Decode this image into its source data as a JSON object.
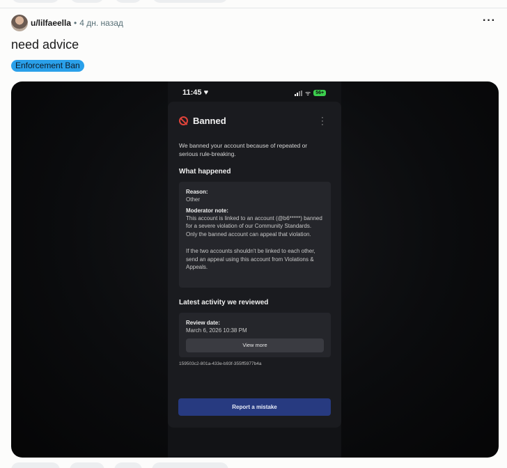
{
  "post": {
    "username": "u/lilfaeella",
    "separator": "•",
    "time_ago": "4 дн. назад",
    "more_label": "···",
    "title": "need advice",
    "flair": "Enforcement Ban"
  },
  "screenshot": {
    "status_bar": {
      "time": "11:45 ♥",
      "wifi": "ᯤ",
      "battery": "56+"
    },
    "card": {
      "title": "Banned",
      "menu": "⋮",
      "intro": "We banned your account because of repeated or serious rule-breaking.",
      "what_happened": {
        "heading": "What happened",
        "reason_label": "Reason:",
        "reason_value": "Other",
        "note_label": "Moderator note:",
        "note_p1": "This account is linked to an account (@b6*****) banned for a severe violation of our Community Standards. Only the banned account can appeal that violation.",
        "note_p2": "If the two accounts shouldn't be linked to each other, send an appeal using this account from Violations & Appeals."
      },
      "latest_activity": {
        "heading": "Latest activity we reviewed",
        "review_label": "Review date:",
        "review_value": "March 6, 2026 10:38 PM",
        "view_more": "View more"
      },
      "uuid": "159503c2-801a-433e-b93f-355ff5977b4a",
      "report_button": "Report a mistake"
    }
  },
  "colors": {
    "flair_bg": "#2aa0ea",
    "report_button_bg": "#273a80",
    "ban_icon": "#e0433a",
    "battery": "#3ccf4e"
  }
}
